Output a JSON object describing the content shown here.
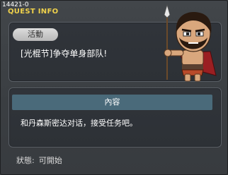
{
  "window": {
    "quest_id": "14421-0",
    "title": "QUEST INFO"
  },
  "quest": {
    "category_tag": "活動",
    "name": "[光棍节]争夺单身部队!"
  },
  "content": {
    "header": "內容",
    "description": "和丹森斯密达对话，接受任务吧。"
  },
  "status": {
    "label": "狀態:",
    "value": "可開始"
  },
  "npc": {
    "icon": "spartan-warrior-npc-icon"
  },
  "colors": {
    "title_accent": "#f0d24b",
    "window_bg": "#3a3e42",
    "panel_bg": "#2f3338",
    "header_bar": "#4a6a7a",
    "tag_bg": "#c8c8c8"
  }
}
